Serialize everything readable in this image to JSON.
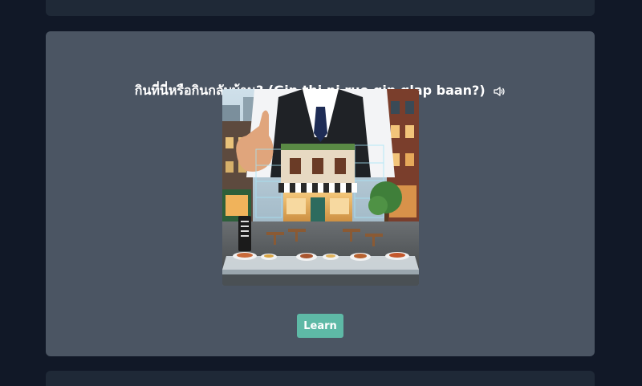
{
  "lesson": {
    "phrase_thai": "กินที่นี่หรือกินกลับบ้าน?",
    "phrase_romanized": "(Gin thi ni rue gin glap baan?)",
    "speaker_icon": "speaker-icon",
    "illustration_icon": "restaurant-illustration",
    "learn_label": "Learn"
  },
  "colors": {
    "background": "#111827",
    "card": "#4b5563",
    "card_dark": "#1f2937",
    "accent": "#5eb9a6"
  }
}
